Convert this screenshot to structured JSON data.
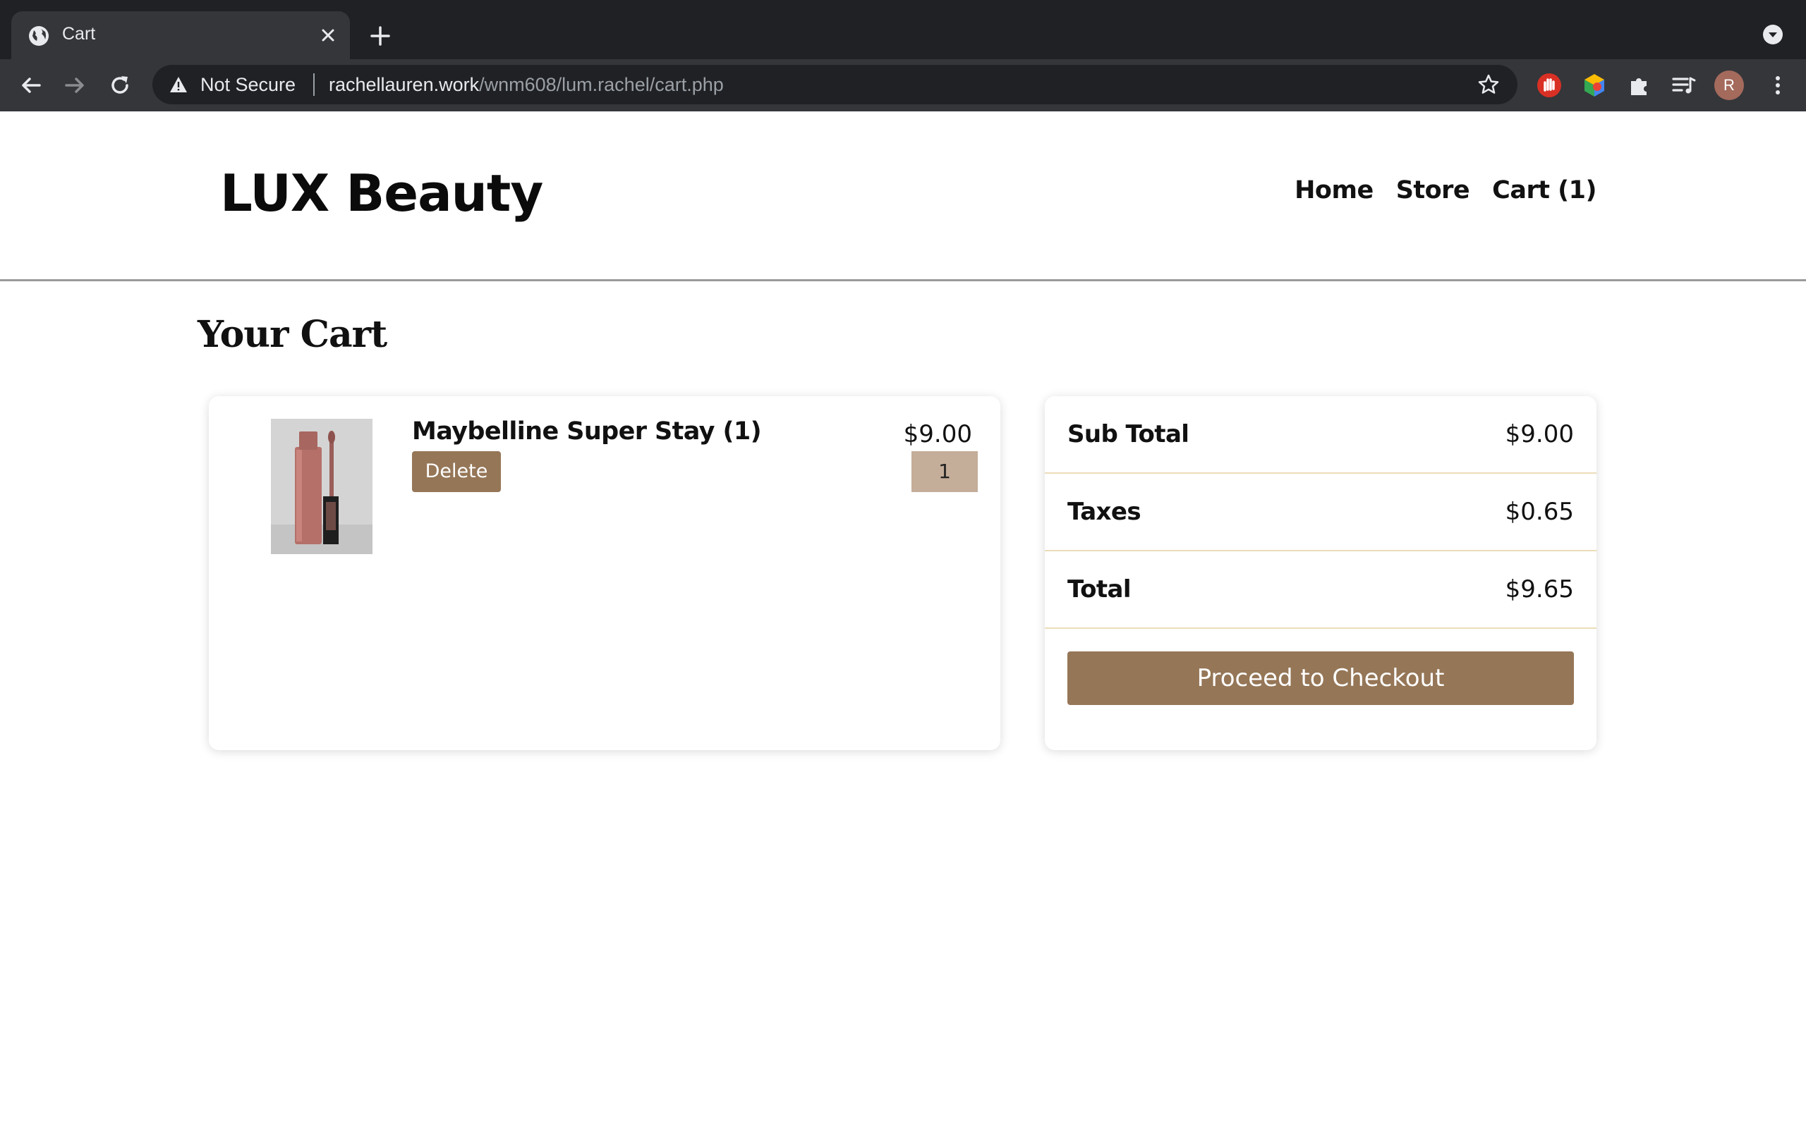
{
  "browser": {
    "tab_title": "Cart",
    "security_label": "Not Secure",
    "url_host": "rachellauren.work",
    "url_path": "/wnm608/lum.rachel/cart.php",
    "profile_initial": "R"
  },
  "site": {
    "brand": "LUX Beauty",
    "nav": [
      {
        "label": "Home"
      },
      {
        "label": "Store"
      },
      {
        "label": "Cart (1)"
      }
    ]
  },
  "cart": {
    "title": "Your Cart",
    "items": [
      {
        "name": "Maybelline Super Stay (1)",
        "price": "$9.00",
        "quantity": "1",
        "delete_label": "Delete"
      }
    ]
  },
  "summary": {
    "rows": [
      {
        "label": "Sub Total",
        "value": "$9.00"
      },
      {
        "label": "Taxes",
        "value": "$0.65"
      },
      {
        "label": "Total",
        "value": "$9.65"
      }
    ],
    "checkout_label": "Proceed to Checkout"
  },
  "colors": {
    "accent": "#957657",
    "quantity_bg": "#c4ad99",
    "summary_divider": "#ecdcb8"
  }
}
